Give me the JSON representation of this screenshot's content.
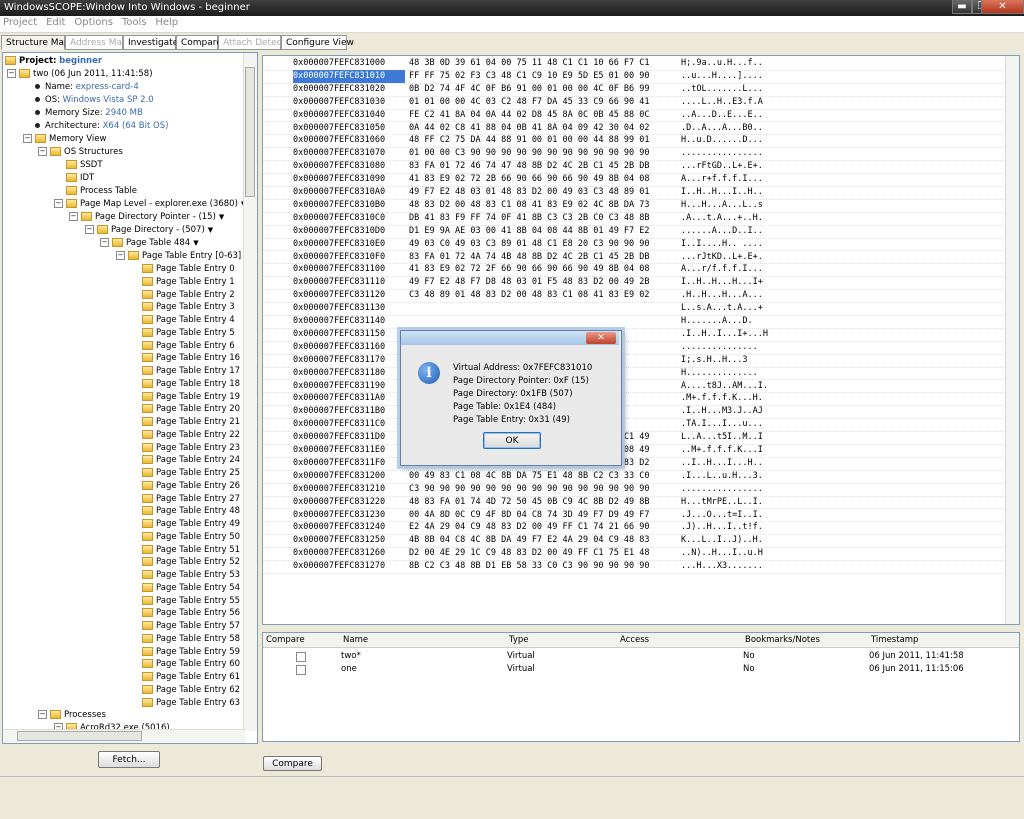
{
  "window": {
    "title": "WindowsSCOPE:Window Into Windows - beginner"
  },
  "titlebar_buttons": {
    "minimize": "▬",
    "restore": "❐",
    "close": "✕"
  },
  "menu": [
    "Project",
    "Edit",
    "Options",
    "Tools",
    "Help"
  ],
  "tabs": [
    "Structure Map",
    "Address Map",
    "Investigate",
    "Compare",
    "Attach Detect",
    "Configure View"
  ],
  "tree": {
    "project_label": "Project:",
    "project_name": "beginner",
    "snapshot": "two (06 Jun 2011, 11:41:58)",
    "props": [
      {
        "label": "Name:",
        "value": "express-card-4"
      },
      {
        "label": "OS:",
        "value": "Windows Vista SP 2.0"
      },
      {
        "label": "Memory Size:",
        "value": "2940 MB"
      },
      {
        "label": "Architecture:",
        "value": "X64 (64 Bit OS)"
      }
    ],
    "memory_view": "Memory View",
    "os_structures": "OS Structures",
    "ssdt": "SSDT",
    "idt": "IDT",
    "process_table": "Process Table",
    "page_map_level": "Page Map Level - explorer.exe (3680)",
    "page_directory_pointer": "Page Directory Pointer - (15)",
    "page_directory": "Page Directory - (507)",
    "page_table": "Page Table 484",
    "page_table_entry_range": "Page Table Entry [0-63]",
    "entries": [
      "Page Table Entry 0",
      "Page Table Entry 1",
      "Page Table Entry 2",
      "Page Table Entry 3",
      "Page Table Entry 4",
      "Page Table Entry 5",
      "Page Table Entry 6",
      "Page Table Entry 16",
      "Page Table Entry 17",
      "Page Table Entry 18",
      "Page Table Entry 19",
      "Page Table Entry 20",
      "Page Table Entry 21",
      "Page Table Entry 22",
      "Page Table Entry 23",
      "Page Table Entry 24",
      "Page Table Entry 25",
      "Page Table Entry 26",
      "Page Table Entry 27",
      "Page Table Entry 48",
      "Page Table Entry 49",
      "Page Table Entry 50",
      "Page Table Entry 51",
      "Page Table Entry 52",
      "Page Table Entry 53",
      "Page Table Entry 54",
      "Page Table Entry 55",
      "Page Table Entry 56",
      "Page Table Entry 57",
      "Page Table Entry 58",
      "Page Table Entry 59",
      "Page Table Entry 60",
      "Page Table Entry 61",
      "Page Table Entry 62",
      "Page Table Entry 63"
    ],
    "processes": "Processes",
    "process_item": "AcroRd32.exe (5016)"
  },
  "fetch_label": "Fetch...",
  "compare_label": "Compare",
  "hex": {
    "selected_index": 1,
    "rows": [
      {
        "addr": "0x000007FEFC831000",
        "bytes": "48 3B 0D 39 61 04 00 75 11 48 C1 C1 10 66 F7 C1",
        "ascii": "H;.9a..u.H...f.."
      },
      {
        "addr": "0x000007FEFC831010",
        "bytes": "FF FF 75 02 F3 C3 48 C1 C9 10 E9 5D E5 01 00 90",
        "ascii": "..u...H....]...."
      },
      {
        "addr": "0x000007FEFC831020",
        "bytes": "0B D2 74 4F 4C 0F B6 91 00 01 00 00 4C 0F B6 99",
        "ascii": "..tOL.......L..."
      },
      {
        "addr": "0x000007FEFC831030",
        "bytes": "01 01 00 00 4C 03 C2 48 F7 DA 45 33 C9 66 90 41",
        "ascii": "....L..H..E3.f.A"
      },
      {
        "addr": "0x000007FEFC831040",
        "bytes": "FE C2 41 8A 04 0A 44 02 D8 45 8A 0C 0B 45 88 0C",
        "ascii": "..A...D..E...E.."
      },
      {
        "addr": "0x000007FEFC831050",
        "bytes": "0A 44 02 C8 41 88 04 0B 41 8A 04 09 42 30 04 02",
        "ascii": ".D..A...A...B0.."
      },
      {
        "addr": "0x000007FEFC831060",
        "bytes": "48 FF C2 75 DA 44 88 91 00 01 00 00 44 88 99 01",
        "ascii": "H..u.D......D..."
      },
      {
        "addr": "0x000007FEFC831070",
        "bytes": "01 00 00 C3 90 90 90 90 90 90 90 90 90 90 90 90",
        "ascii": "................"
      },
      {
        "addr": "0x000007FEFC831080",
        "bytes": "83 FA 01 72 46 74 47 48 8B D2 4C 2B C1 45 2B DB",
        "ascii": "...rFtGD..L+.E+."
      },
      {
        "addr": "0x000007FEFC831090",
        "bytes": "41 83 E9 02 72 2B 66 90 66 90 66 90 49 8B 04 08",
        "ascii": "A...r+f.f.f.I..."
      },
      {
        "addr": "0x000007FEFC8310A0",
        "bytes": "49 F7 E2 48 03 01 48 83 D2 00 49 03 C3 48 89 01",
        "ascii": "I..H..H...I..H.."
      },
      {
        "addr": "0x000007FEFC8310B0",
        "bytes": "48 83 D2 00 48 83 C1 08 41 83 E9 02 4C 8B DA 73",
        "ascii": "H...H...A...L..s"
      },
      {
        "addr": "0x000007FEFC8310C0",
        "bytes": "DB 41 83 F9 FF 74 0F 41 8B C3 C3 2B C0 C3 48 8B",
        "ascii": ".A...t.A...+..H."
      },
      {
        "addr": "0x000007FEFC8310D0",
        "bytes": "D1 E9 9A AE 03 00 41 8B 04 08 44 8B 01 49 F7 E2",
        "ascii": "......A...D..I.."
      },
      {
        "addr": "0x000007FEFC8310E0",
        "bytes": "49 03 C0 49 03 C3 89 01 48 C1 E8 20 C3 90 90 90",
        "ascii": "I..I....H.. ...."
      },
      {
        "addr": "0x000007FEFC8310F0",
        "bytes": "83 FA 01 72 4A 74 4B 48 8B D2 4C 2B C1 45 2B DB",
        "ascii": "...rJtKD..L+.E+."
      },
      {
        "addr": "0x000007FEFC831100",
        "bytes": "41 83 E9 02 72 2F 66 90 66 90 66 90 49 8B 04 08",
        "ascii": "A...r/f.f.f.I..."
      },
      {
        "addr": "0x000007FEFC831110",
        "bytes": "49 F7 E2 48 F7 D8 48 03 01 F5 48 83 D2 00 49 2B",
        "ascii": "I..H..H...H...I+"
      },
      {
        "addr": "0x000007FEFC831120",
        "bytes": "C3 48 89 01 48 83 D2 00 48 83 C1 08 41 83 E9 02",
        "ascii": ".H..H...H...A..."
      },
      {
        "addr": "0x000007FEFC831130",
        "bytes": "",
        "ascii": "L..s.A...t.A...+"
      },
      {
        "addr": "0x000007FEFC831140",
        "bytes": "",
        "ascii": "H.......A...D."
      },
      {
        "addr": "0x000007FEFC831150",
        "bytes": "",
        "ascii": ".I..H..I...I+...H"
      },
      {
        "addr": "0x000007FEFC831160",
        "bytes": "",
        "ascii": "..............."
      },
      {
        "addr": "0x000007FEFC831170",
        "bytes": "",
        "ascii": "I;.s.H..H...3"
      },
      {
        "addr": "0x000007FEFC831180",
        "bytes": "",
        "ascii": "H.............."
      },
      {
        "addr": "0x000007FEFC831190",
        "bytes": "",
        "ascii": "A....t8J..AM...I."
      },
      {
        "addr": "0x000007FEFC8311A0",
        "bytes": "",
        "ascii": ".M+.f.f.f.K...H."
      },
      {
        "addr": "0x000007FEFC8311B0",
        "bytes": "",
        "ascii": ".I..H...M3.J..AJ"
      },
      {
        "addr": "0x000007FEFC8311C0",
        "bytes": "",
        "ascii": ".TA.I...I...u..."
      },
      {
        "addr": "0x000007FEFC8311D0",
        "bytes": "4C 8B D2 41 C1 E1 03 74 35 49 03 C9 4D 03 C1 49",
        "ascii": "L..A...t5I..M..I"
      },
      {
        "addr": "0x000007FEFC8311E0",
        "bytes": "F7 D9 4D 2B DB 66 90 66 90 66 90 4B 8B 04 08 49",
        "ascii": "..M+.f.f.f.K...I"
      },
      {
        "addr": "0x000007FEFC8311F0",
        "bytes": "F7 E2 49 03 C3 48 83 D2 00 49 01 04 09 48 83 D2",
        "ascii": "..I..H...I...H.."
      },
      {
        "addr": "0x000007FEFC831200",
        "bytes": "00 49 83 C1 08 4C 8B DA 75 E1 48 8B C2 C3 33 C0",
        "ascii": ".I...L..u.H...3."
      },
      {
        "addr": "0x000007FEFC831210",
        "bytes": "C3 90 90 90 90 90 90 90 90 90 90 90 90 90 90 90",
        "ascii": "................"
      },
      {
        "addr": "0x000007FEFC831220",
        "bytes": "48 83 FA 01 74 4D 72 50 45 0B C9 4C 8B D2 49 8B",
        "ascii": "H...tMrPE..L..I."
      },
      {
        "addr": "0x000007FEFC831230",
        "bytes": "00 4A 8D 0C C9 4F 8D 04 C8 74 3D 49 F7 D9 49 F7",
        "ascii": ".J...O...t=I..I."
      },
      {
        "addr": "0x000007FEFC831240",
        "bytes": "E2 4A 29 04 C9 48 83 D2 00 49 FF C1 74 21 66 90",
        "ascii": ".J)..H...I..t!f."
      },
      {
        "addr": "0x000007FEFC831250",
        "bytes": "4B 8B 04 C8 4C 8B DA 49 F7 E2 4A 29 04 C9 48 83",
        "ascii": "K...L..I..J)..H."
      },
      {
        "addr": "0x000007FEFC831260",
        "bytes": "D2 00 4E 29 1C C9 48 83 D2 00 49 FF C1 75 E1 48",
        "ascii": "..N)..H...I..u.H"
      },
      {
        "addr": "0x000007FEFC831270",
        "bytes": "8B C2 C3 48 8B D1 EB 58 33 C0 C3 90 90 90 90 90",
        "ascii": "...H...X3......."
      }
    ]
  },
  "bookmarks": {
    "columns": [
      "Compare",
      "Name",
      "Type",
      "Access",
      "Bookmarks/Notes",
      "Timestamp"
    ],
    "rows": [
      {
        "name": "two*",
        "type": "Virtual",
        "access": "",
        "notes": "No",
        "timestamp": "06 Jun 2011, 11:41:58"
      },
      {
        "name": "one",
        "type": "Virtual",
        "access": "",
        "notes": "No",
        "timestamp": "06 Jun 2011, 11:15:06"
      }
    ]
  },
  "dialog": {
    "close_label": "✕",
    "icon_glyph": "i",
    "lines": [
      "Virtual Address: 0x7FEFC831010",
      "Page Directory Pointer: 0xF (15)",
      "Page Directory: 0x1FB (507)",
      "Page Table: 0x1E4 (484)",
      "Page Table Entry: 0x31 (49)"
    ],
    "ok_label": "OK"
  }
}
